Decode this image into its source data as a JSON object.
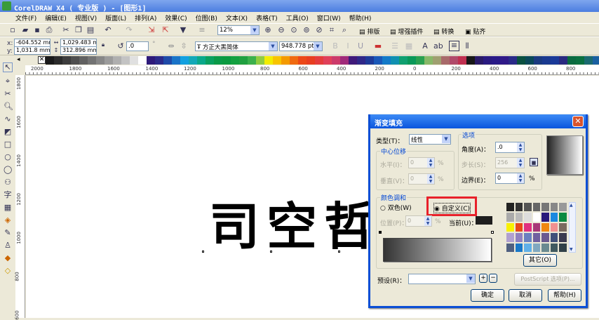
{
  "window": {
    "title": "CorelDRAW X4 ( 专业版 ) - [图形1]"
  },
  "menu": [
    "文件(F)",
    "编辑(E)",
    "视图(V)",
    "版面(L)",
    "排列(A)",
    "效果(C)",
    "位图(B)",
    "文本(X)",
    "表格(T)",
    "工具(O)",
    "窗口(W)",
    "帮助(H)"
  ],
  "toolbar": {
    "zoom": "12%",
    "plugins": [
      "排版",
      "增强插件",
      "转换",
      "贴齐"
    ]
  },
  "property_bar": {
    "x": "-604.552 mm",
    "y": "1,031.8 mm",
    "width": "1,029.483 mm",
    "height": "312.896 mm",
    "rotation": ".0",
    "degree_symbol": "°",
    "font": "方正大黑简体",
    "font_size": "948.778 pt"
  },
  "palette": [
    "#1a1a1a",
    "#2b2b2b",
    "#3d3d3d",
    "#4f4f4f",
    "#616161",
    "#737373",
    "#878787",
    "#9b9b9b",
    "#afafaf",
    "#c3c3c3",
    "#e0e0e0",
    "#ffffff",
    "#2e1a7a",
    "#2b2a8a",
    "#1f4aa8",
    "#1a74c8",
    "#12a0e0",
    "#13a8b8",
    "#0aa88a",
    "#0aa060",
    "#0a9a48",
    "#0a9a40",
    "#13a040",
    "#20a040",
    "#3cb04c",
    "#90cc40",
    "#f2ec00",
    "#f8c400",
    "#f49a00",
    "#f06a10",
    "#ec4818",
    "#e83e20",
    "#e43c3c",
    "#e0405a",
    "#cc3a6a",
    "#a02a7a",
    "#401a7a",
    "#302888",
    "#1e3a98",
    "#1a58b8",
    "#137ac8",
    "#1090b0",
    "#10a070",
    "#0a9858",
    "#2aa050",
    "#88b868",
    "#a0a070",
    "#a86a6a",
    "#b04a6a",
    "#c03050",
    "#181818",
    "#2a1a66",
    "#2a1a80",
    "#2a1a88",
    "#301a88",
    "#2a2a88",
    "#0a5040",
    "#0a4858",
    "#1a3a80",
    "#1a3a90",
    "#1a3a98",
    "#2a2a80",
    "#0a6a40",
    "#0a7040",
    "#1a6a70",
    "#1a60a0",
    "#0a70c0",
    "#1a4aa0"
  ],
  "rulers": {
    "horizontal": [
      "2000",
      "1800",
      "1600",
      "1400",
      "1200",
      "1000",
      "800",
      "600",
      "400",
      "200",
      "0",
      "200",
      "400",
      "600",
      "800"
    ],
    "vertical": [
      "1800",
      "1600",
      "1400",
      "1200",
      "1000",
      "800",
      "600"
    ]
  },
  "canvas": {
    "text": "司空哲"
  },
  "dialog": {
    "title": "渐变填充",
    "type_label": "类型(T)：",
    "type_value": "线性",
    "center_offset": {
      "title": "中心位移",
      "horizontal_label": "水平(I)：",
      "horizontal_value": "0",
      "vertical_label": "垂直(V)：",
      "vertical_value": "0",
      "unit": "%"
    },
    "options": {
      "title": "选项",
      "angle_label": "角度(A)：",
      "angle_value": ".0",
      "steps_label": "步长(S)：",
      "steps_value": "256",
      "edge_label": "边界(E)：",
      "edge_value": "0",
      "unit": "%"
    },
    "color_blend": {
      "title": "颜色调和",
      "two_color": "双色(W)",
      "custom": "自定义(C)",
      "selected": "custom",
      "position_label": "位置(P)：",
      "position_value": "0",
      "unit": "%",
      "current_label": "当前(U)：",
      "current_color": "#1e1e1e"
    },
    "swatches": [
      "#222222",
      "#333333",
      "#555555",
      "#666666",
      "#777777",
      "#888888",
      "#999999",
      "#aaaaaa",
      "#bbbbbb",
      "#dddddd",
      "#ffffff",
      "#2a1a7a",
      "#1a88e0",
      "#0a8a40",
      "#f8f000",
      "#e84818",
      "#e03080",
      "#a83878",
      "#f08810",
      "#f09090",
      "#7a6a60",
      "#b0a0d0",
      "#9080c0",
      "#6a80c0",
      "#7060a0",
      "#6a5a90",
      "#40507a",
      "#3a3a50",
      "#506080",
      "#1a78c8",
      "#60b0e8",
      "#80a8c0",
      "#6a8a90",
      "#405a60",
      "#304048"
    ],
    "other_button": "其它(O)",
    "preset_label": "预设(R)：",
    "preset_value": "",
    "postscript_button": "PostScript 选项(P)...",
    "ok": "确定",
    "cancel": "取消",
    "help": "帮助(H)",
    "highlight_color": "#e8202a"
  }
}
